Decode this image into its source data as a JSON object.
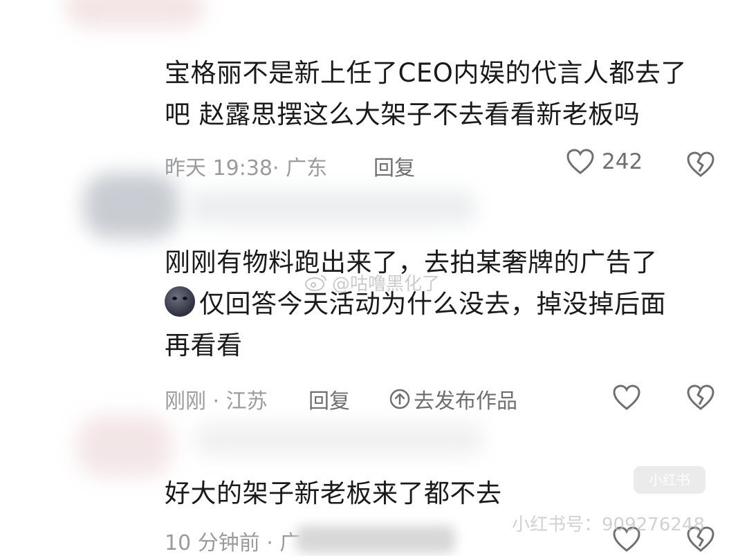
{
  "comments": [
    {
      "text_line1": "宝格丽不是新上任了CEO内娱的代言人都去了",
      "text_line2": "吧 赵露思摆这么大架子不去看看新老板吗",
      "meta": "昨天 19:38· 广东",
      "reply": "回复",
      "likes": "242"
    },
    {
      "text_line1": "刚刚有物料跑出来了，去拍某奢牌的广告了",
      "text_line2": "仅回答今天活动为什么没去，掉没掉后面",
      "text_line3": "再看看",
      "meta": "刚刚 · 江苏",
      "reply": "回复",
      "publish": "去发布作品",
      "emoji": "new-moon-face"
    },
    {
      "text_line1": "好大的架子新老板来了都不去",
      "meta": "10 分钟前 · 广"
    }
  ],
  "watermarks": {
    "weibo": "@咕噜黑化了",
    "xhs_id": "小红书号：909276248",
    "xhs_logo": "小红书"
  },
  "colors": {
    "text": "#1a1a1a",
    "meta": "#9b9b9b",
    "action": "#6f6f6f"
  }
}
